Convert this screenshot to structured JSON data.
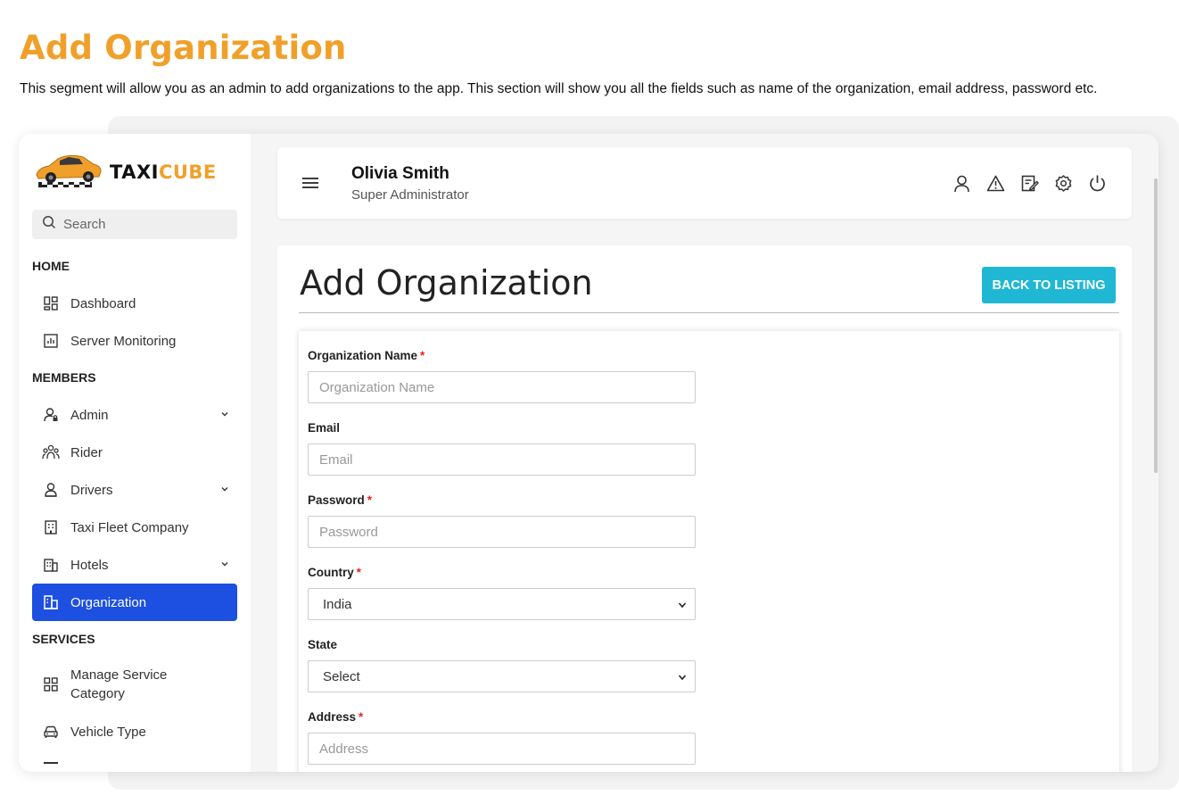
{
  "doc": {
    "title": "Add Organization",
    "description": "This segment will allow you as an admin to add organizations to the app. This section will show you all the fields such as name of the organization, email address, password etc."
  },
  "logo": {
    "part1": "TAXI",
    "part2": "CUBE"
  },
  "search": {
    "label": "Search"
  },
  "sidebar": {
    "home_label": "HOME",
    "members_label": "MEMBERS",
    "services_label": "SERVICES",
    "items": [
      {
        "label": "Dashboard"
      },
      {
        "label": "Server Monitoring"
      },
      {
        "label": "Admin"
      },
      {
        "label": "Rider"
      },
      {
        "label": "Drivers"
      },
      {
        "label": "Taxi Fleet Company"
      },
      {
        "label": "Hotels"
      },
      {
        "label": "Organization"
      },
      {
        "label": "Manage Service Category"
      },
      {
        "label": "Vehicle Type"
      }
    ],
    "active": "Organization"
  },
  "header": {
    "user_name": "Olivia Smith",
    "user_role": "Super Administrator"
  },
  "page": {
    "title": "Add Organization",
    "back_button": "BACK TO LISTING"
  },
  "form": {
    "org_name": {
      "label": "Organization Name",
      "placeholder": "Organization Name",
      "required": "*"
    },
    "email": {
      "label": "Email",
      "placeholder": "Email"
    },
    "password": {
      "label": "Password",
      "placeholder": "Password",
      "required": "*"
    },
    "country": {
      "label": "Country",
      "value": "India",
      "required": "*"
    },
    "state": {
      "label": "State",
      "value": "Select"
    },
    "address": {
      "label": "Address",
      "placeholder": "Address",
      "required": "*"
    }
  },
  "colors": {
    "accent": "#f0a02a",
    "active_nav": "#1d4fe0",
    "button": "#1fb7d4",
    "required": "#e22222"
  },
  "icons": [
    "search-icon",
    "dashboard-icon",
    "chart-icon",
    "admin-icon",
    "rider-icon",
    "driver-icon",
    "building-icon",
    "hotel-icon",
    "organization-icon",
    "grid-icon",
    "car-icon",
    "menu-icon",
    "user-icon",
    "alert-icon",
    "edit-icon",
    "settings-icon",
    "power-icon"
  ]
}
